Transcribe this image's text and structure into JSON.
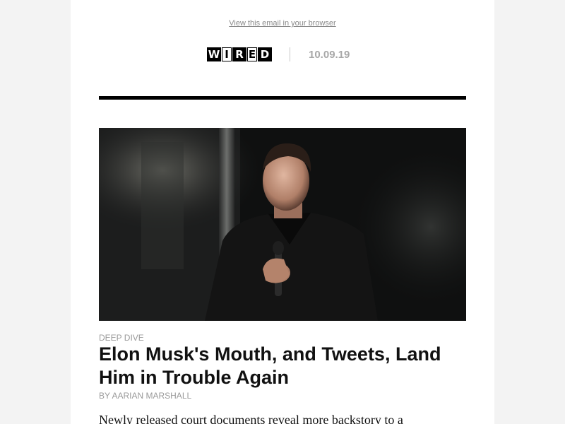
{
  "header": {
    "view_in_browser": "View this email in your browser",
    "logo": {
      "brand": "WIRED",
      "letters": [
        "W",
        "I",
        "R",
        "E",
        "D"
      ]
    },
    "date": "10.09.19"
  },
  "article": {
    "hero_image_alt": "Elon Musk holding a microphone",
    "kicker": "DEEP DIVE",
    "headline": "Elon Musk's Mouth, and Tweets, Land Him in Trouble Again",
    "byline": "BY AARIAN MARSHALL",
    "dek": "Newly released court documents reveal more backstory to a"
  },
  "colors": {
    "page_background": "#f3f3f3",
    "email_background": "#ffffff",
    "rule": "#000000",
    "muted_text": "#9a9a9a",
    "date_text": "#a8a8a8",
    "headline_text": "#111111"
  }
}
